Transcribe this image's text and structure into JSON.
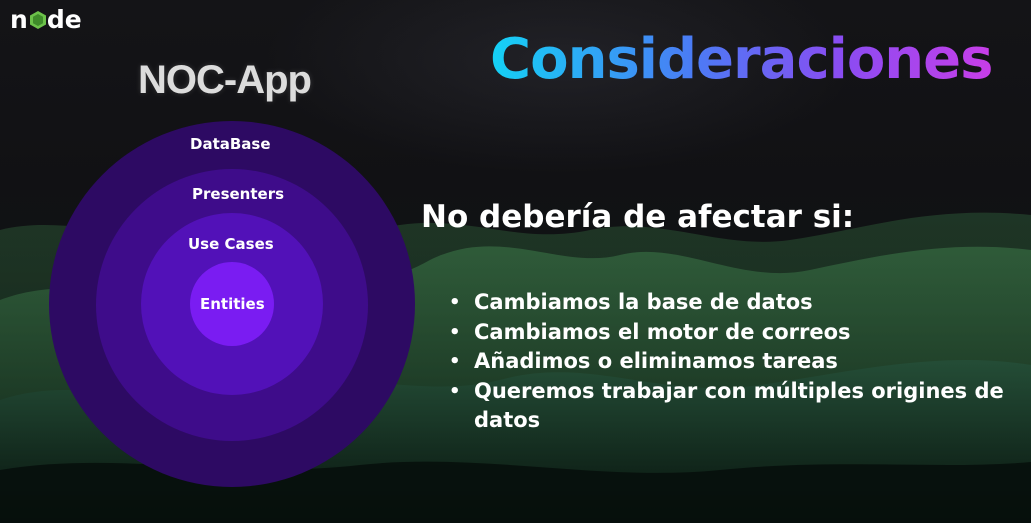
{
  "logo": {
    "text_left": "n",
    "text_right": "de",
    "icon": "node-hexagon-icon"
  },
  "title": "Consideraciones",
  "app_name": "NOC-App",
  "layers": {
    "database": "DataBase",
    "presenters": "Presenters",
    "use_cases": "Use Cases",
    "entities": "Entities"
  },
  "subheading": "No debería de afectar si:",
  "bullets": [
    "Cambiamos la base de datos",
    "Cambiamos el motor de correos",
    "Añadimos o eliminamos tareas",
    "Queremos trabajar con múltiples origines de datos"
  ],
  "bullet_symbol": "•",
  "colors": {
    "title_gradient_start": "#14d2f5",
    "title_gradient_end": "#c83ee8",
    "circle_outer": "#2d0a63",
    "circle_2": "#3e0c8a",
    "circle_3": "#5211b8",
    "circle_inner": "#7a1cf2",
    "logo_green": "#6cc24a"
  }
}
